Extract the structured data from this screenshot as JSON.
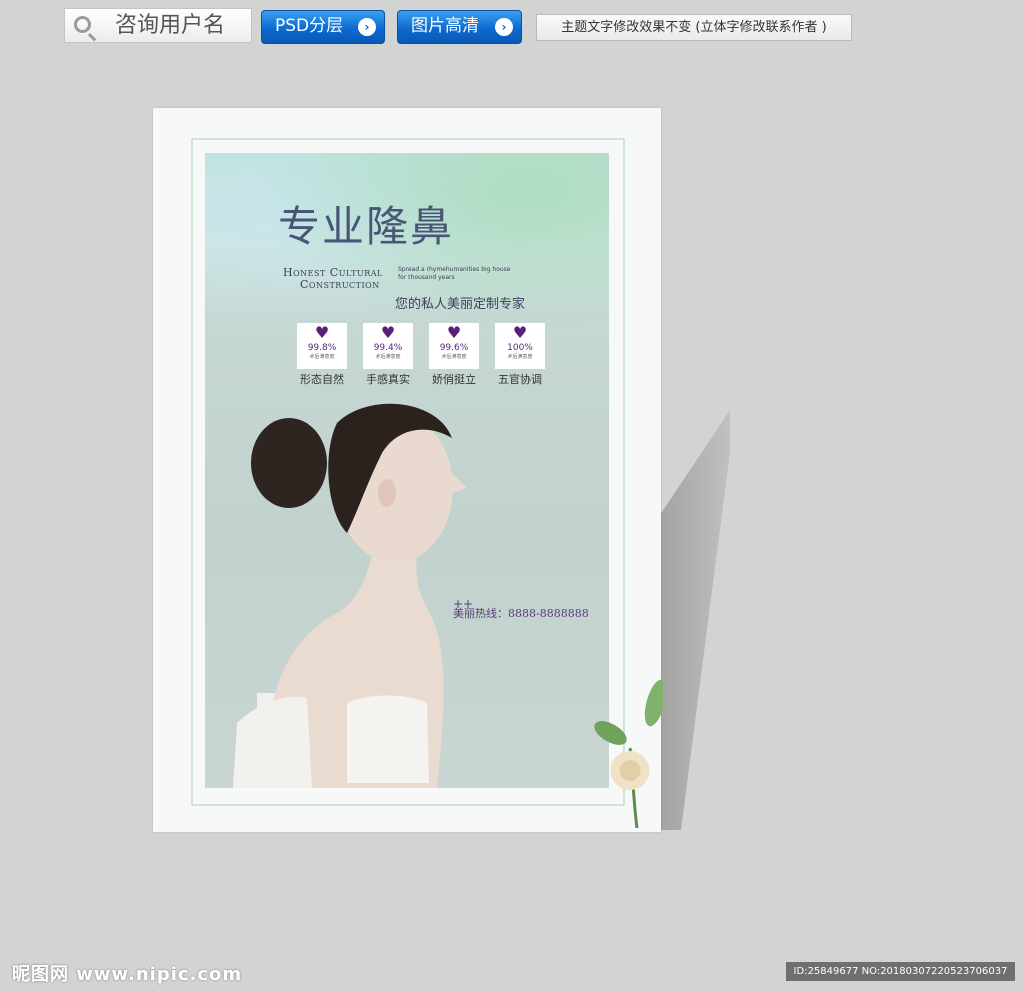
{
  "toolbar": {
    "search_text": "咨询用户名",
    "psd_button": "PSD分层",
    "hd_button": "图片高清",
    "note": "主题文字修改效果不变 (立体字修改联系作者 )"
  },
  "poster": {
    "title": "专业隆鼻",
    "en_line1": "Honest Cultural",
    "en_line2": "Construction",
    "en_small": "Spread a rhymehumanities big house for thousand years",
    "subtitle": "您的私人美丽定制专家",
    "badges": [
      {
        "pct": "99.8%",
        "small": "术后满意度",
        "label": "形态自然"
      },
      {
        "pct": "99.4%",
        "small": "术后满意度",
        "label": "手感真实"
      },
      {
        "pct": "99.6%",
        "small": "术后满意度",
        "label": "娇俏挺立"
      },
      {
        "pct": "100%",
        "small": "术后满意度",
        "label": "五官协调"
      }
    ],
    "hotline": "美丽热线：8888-8888888",
    "plus": "++"
  },
  "footer": {
    "watermark": "昵图网 www.nipic.com",
    "id_text": "ID:25849677 NO:20180307220523706037"
  },
  "colors": {
    "button": "#0d6ad0",
    "title": "#4a5677",
    "heart": "#5b1f7a"
  }
}
